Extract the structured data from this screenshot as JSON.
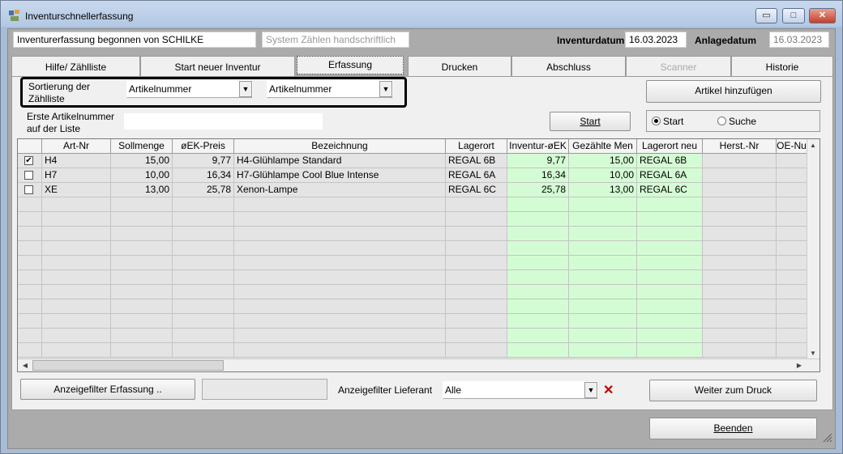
{
  "window": {
    "title": "Inventurschnellerfassung",
    "min": "▭",
    "max": "□",
    "close": "✕"
  },
  "header": {
    "started_by": "Inventurerfassung begonnen von SCHILKE",
    "mode": "System Zählen handschriftlich",
    "inventory_date_label": "Inventurdatum",
    "inventory_date": "16.03.2023",
    "creation_date_label": "Anlagedatum",
    "creation_date": "16.03.2023"
  },
  "tabs": [
    {
      "label": "Hilfe/ Zählliste"
    },
    {
      "label": "Start neuer Inventur"
    },
    {
      "label": "Erfassung"
    },
    {
      "label": "Drucken"
    },
    {
      "label": "Abschluss"
    },
    {
      "label": "Scanner"
    },
    {
      "label": "Historie"
    }
  ],
  "sort": {
    "label": "Sortierung der Zählliste",
    "label_line1": "Sortierung der",
    "label_line2": "Zählliste",
    "primary": "Artikelnummer",
    "secondary": "Artikelnummer"
  },
  "first_article": {
    "label_line1": "Erste Artikelnummer",
    "label_line2": "auf der Liste",
    "value": ""
  },
  "buttons": {
    "add_article": "Artikel hinzufügen",
    "start": "Start",
    "display_filter": "Anzeigefilter Erfassung ..",
    "next_print": "Weiter zum Druck",
    "quit": "Beenden"
  },
  "search_mode": {
    "start": "Start",
    "search": "Suche"
  },
  "filter": {
    "supplier_label": "Anzeigefilter Lieferant",
    "supplier_value": "Alle",
    "clear_icon": "✕"
  },
  "columns": [
    "Art-Nr",
    "Sollmenge",
    "øEK-Preis",
    "Bezeichnung",
    "Lagerort",
    "Inventur-øEK",
    "Gezählte Men",
    "Lagerort neu",
    "Herst.-Nr",
    "OE-Nu"
  ],
  "rows": [
    {
      "checked": "✔",
      "art": "H4",
      "soll": "15,00",
      "ek": "9,77",
      "bez": "H4-Glühlampe Standard",
      "lager": "REGAL 6B",
      "inv_ek": "9,77",
      "gezaehlt": "15,00",
      "lager_neu": "REGAL 6B",
      "herst": "",
      "oe": ""
    },
    {
      "checked": "",
      "art": "H7",
      "soll": "10,00",
      "ek": "16,34",
      "bez": "H7-Glühlampe Cool Blue Intense",
      "lager": "REGAL 6A",
      "inv_ek": "16,34",
      "gezaehlt": "10,00",
      "lager_neu": "REGAL 6A",
      "herst": "",
      "oe": ""
    },
    {
      "checked": "",
      "art": "XE",
      "soll": "13,00",
      "ek": "25,78",
      "bez": "Xenon-Lampe",
      "lager": "REGAL 6C",
      "inv_ek": "25,78",
      "gezaehlt": "13,00",
      "lager_neu": "REGAL 6C",
      "herst": "",
      "oe": ""
    }
  ],
  "colors": {
    "counted_column": "#d4fcd4",
    "clear_icon": "#c00000"
  }
}
